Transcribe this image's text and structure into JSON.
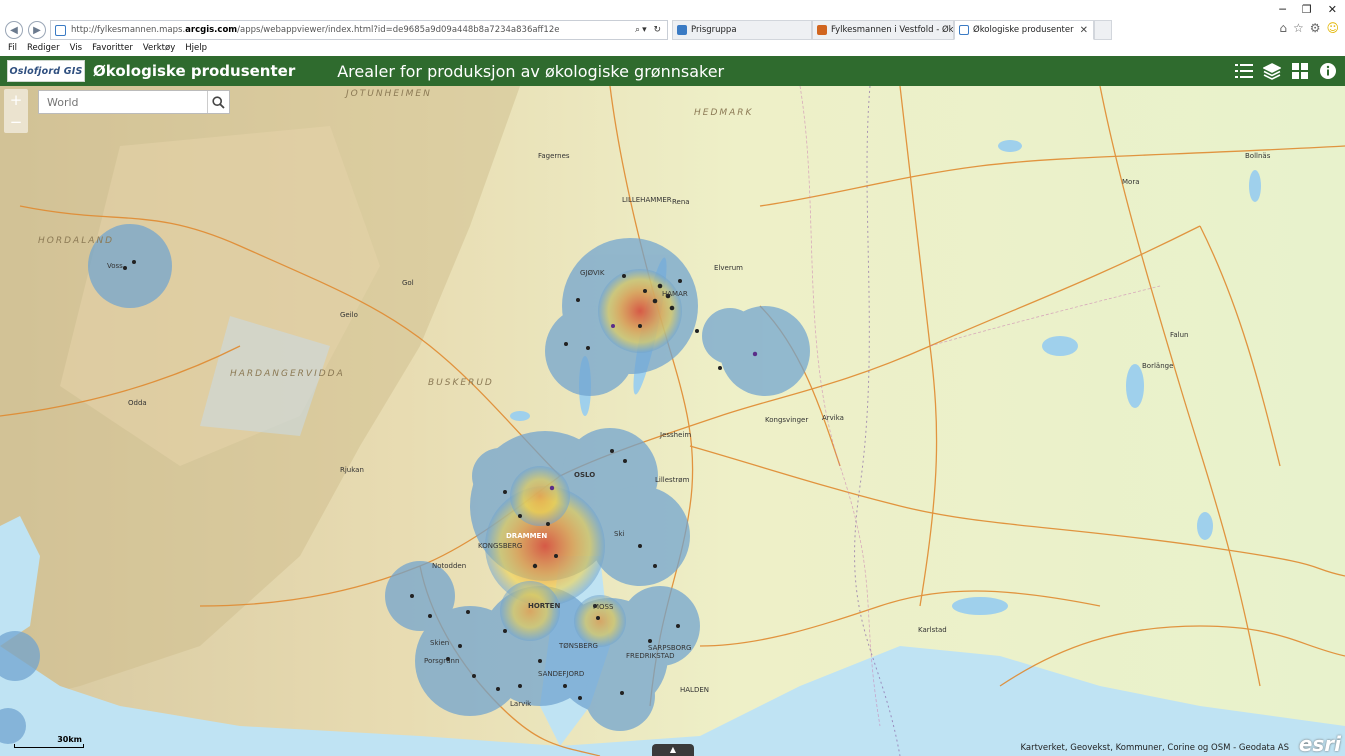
{
  "browser": {
    "url_prefix": "http://fylkesmannen.maps.",
    "url_domain": "arcgis.com",
    "url_rest": "/apps/webappviewer/index.html?id=de9685a9d09a448b8a7234a836aff12e",
    "tabs": [
      {
        "label": "Prisgruppa",
        "active": false,
        "icon_color": "#3b7bc4"
      },
      {
        "label": "Fylkesmannen i Vestfold - Økol...",
        "active": false,
        "icon_color": "#d1651f"
      },
      {
        "label": "Økologiske produsenter",
        "active": true,
        "icon_color": "#3b7bc4"
      }
    ],
    "menu": [
      "Fil",
      "Rediger",
      "Vis",
      "Favoritter",
      "Verktøy",
      "Hjelp"
    ]
  },
  "app": {
    "logo_text": "Oslofjord GIS",
    "title": "Økologiske produsenter",
    "subtitle": "Arealer for produksjon av økologiske grønnsaker",
    "header_color": "#2f6b2e",
    "tools": [
      "legend-icon",
      "layers-icon",
      "basemap-gallery-icon",
      "about-icon"
    ]
  },
  "map": {
    "search_placeholder": "World",
    "zoom_in": "+",
    "zoom_out": "−",
    "scale_label": "30km",
    "attribution": "Kartverket, Geovekst, Kommuner, Corine og OSM - Geodata AS",
    "logo": "esri",
    "places": [
      "JOTUNHEIMEN",
      "HORDALAND",
      "HARDANGERVIDDA",
      "BUSKERUD",
      "HEDMARK",
      "OSLO",
      "DRAMMEN",
      "HORTEN",
      "TØNSBERG",
      "SANDEFJORD",
      "MOSS",
      "FREDRIKSTAD",
      "SARPSBORG",
      "HALDEN",
      "LILLEHAMMER",
      "GJØVIK",
      "HAMAR",
      "KONGSBERG",
      "Lillestrøm",
      "Ski",
      "Jessheim",
      "Kongsvinger",
      "Rjukan",
      "Notodden",
      "Larvik",
      "Skien",
      "Porsgrunn",
      "Gol",
      "Geilo",
      "Fagernes",
      "Elverum",
      "Rena",
      "Voss",
      "Odda",
      "Falun",
      "Borlänge",
      "Karlstad",
      "Arvika",
      "Bollnäs",
      "Mora"
    ],
    "heat_colors": {
      "low": "#6fa3d0",
      "mid": "#f2d24a",
      "high": "#e2492f"
    }
  }
}
